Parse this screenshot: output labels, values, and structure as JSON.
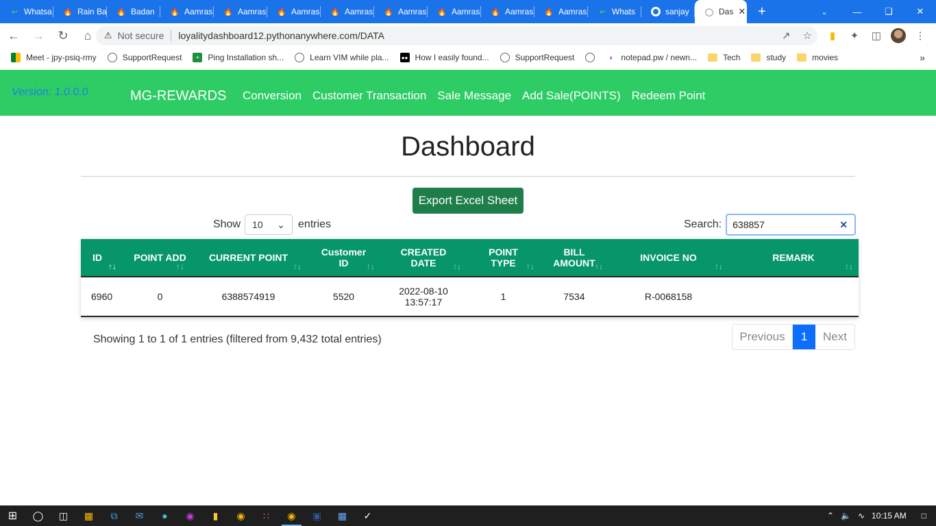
{
  "browser": {
    "tabs": [
      {
        "title": "Whatsa",
        "icon": "whatsapp-icon"
      },
      {
        "title": "Rain Ba",
        "icon": "fire-icon"
      },
      {
        "title": "Badan",
        "icon": "fire-icon"
      },
      {
        "title": "Aamras",
        "icon": "fire-icon"
      },
      {
        "title": "Aamras",
        "icon": "fire-icon"
      },
      {
        "title": "Aamras",
        "icon": "fire-icon"
      },
      {
        "title": "Aamras",
        "icon": "fire-icon"
      },
      {
        "title": "Aamras",
        "icon": "fire-icon"
      },
      {
        "title": "Aamras",
        "icon": "fire-icon"
      },
      {
        "title": "Aamras",
        "icon": "fire-icon"
      },
      {
        "title": "Aamras",
        "icon": "fire-icon"
      },
      {
        "title": "Whats",
        "icon": "whatsapp-icon"
      },
      {
        "title": "sanjay",
        "icon": "github-icon"
      }
    ],
    "active_tab": {
      "title": "Das",
      "icon": "globe-icon"
    },
    "security_label": "Not secure",
    "url": "loyalitydashboard12.pythonanywhere.com/DATA",
    "bookmarks": [
      {
        "label": "Meet - jpy-psiq-rmy",
        "icon": "meet-icon"
      },
      {
        "label": "SupportRequest",
        "icon": "globe-icon"
      },
      {
        "label": "Ping Installation sh...",
        "icon": "sheets-icon"
      },
      {
        "label": "Learn VIM while pla...",
        "icon": "globe-icon"
      },
      {
        "label": "How I easily found...",
        "icon": "medium-icon"
      },
      {
        "label": "SupportRequest",
        "icon": "globe-icon"
      },
      {
        "label": "",
        "icon": "globe-icon"
      },
      {
        "label": "notepad.pw / newn...",
        "icon": "notepad-icon"
      },
      {
        "label": "Tech",
        "icon": "folder-icon"
      },
      {
        "label": "study",
        "icon": "folder-icon"
      },
      {
        "label": "movies",
        "icon": "folder-icon"
      }
    ]
  },
  "navbar": {
    "version": "Version: 1.0.0.0",
    "brand": "MG-REWARDS",
    "links": [
      "Conversion",
      "Customer Transaction",
      "Sale Message",
      "Add Sale(POINTS)",
      "Redeem Point"
    ]
  },
  "page": {
    "title": "Dashboard",
    "export_label": "Export Excel Sheet",
    "show_label": "Show",
    "entries_label": "entries",
    "page_length": "10",
    "search_label": "Search:",
    "search_value": "638857"
  },
  "table": {
    "columns": [
      {
        "label": "ID",
        "sorted": true
      },
      {
        "label": "POINT ADD",
        "sorted": false
      },
      {
        "label": "CURRENT POINT",
        "sorted": false
      },
      {
        "label": "Customer ID",
        "sorted": false
      },
      {
        "label": "CREATED DATE",
        "sorted": false
      },
      {
        "label": "POINT TYPE",
        "sorted": false
      },
      {
        "label": "BILL AMOUNT",
        "sorted": false
      },
      {
        "label": "INVOICE NO",
        "sorted": false
      },
      {
        "label": "REMARK",
        "sorted": false
      }
    ],
    "rows": [
      [
        "6960",
        "0",
        "6388574919",
        "5520",
        "2022-08-10 13:57:17",
        "1",
        "7534",
        "R-0068158",
        ""
      ]
    ]
  },
  "footer": {
    "info": "Showing 1 to 1 of 1 entries (filtered from 9,432 total entries)",
    "previous": "Previous",
    "current_page": "1",
    "next": "Next"
  },
  "taskbar": {
    "clock": "10:15 AM"
  },
  "colors": {
    "nav_green": "#2ecc65",
    "header_green": "#07956a",
    "export_green": "#1e7e4a",
    "page_blue": "#0d6efd",
    "chrome_blue": "#1a73e8"
  }
}
